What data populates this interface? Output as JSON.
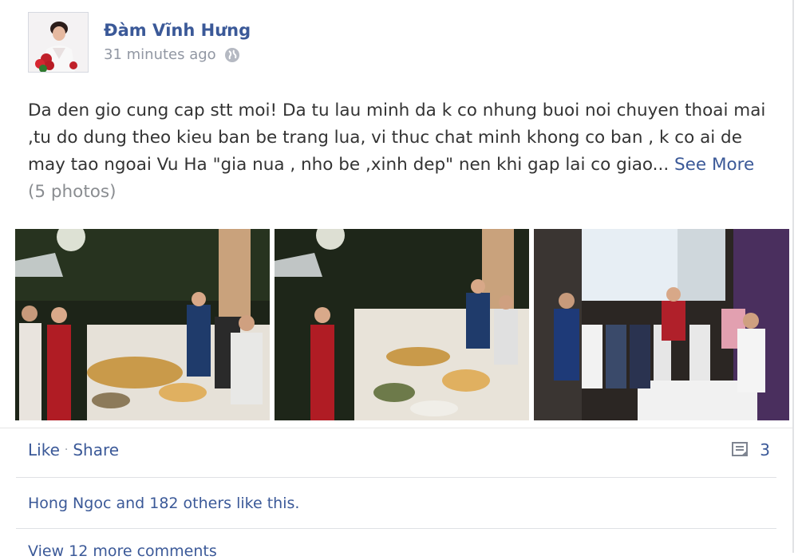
{
  "post": {
    "author": "Đàm Vĩnh Hưng",
    "time": "31 minutes ago",
    "privacy_icon": "globe-icon",
    "text": "Da den gio cung cap stt moi! Da tu lau minh da k co nhung buoi noi chuyen thoai mai ,tu do dung theo kieu ban be trang lua, vi thuc chat minh khong co ban , k co ai de may tao ngoai Vu Ha \"gia nua , nho be ,xinh dep\" nen khi gap lai co giao...",
    "see_more": "See More",
    "photo_count": "(5 photos)"
  },
  "actions": {
    "like": "Like",
    "separator": "·",
    "share": "Share",
    "comment_icon": "comment-icon",
    "comment_count": "3"
  },
  "likes": {
    "name": "Hong Ngoc",
    "rest": " and 182 others like this."
  },
  "comments": {
    "view_more": "View 12 more comments"
  },
  "colors": {
    "link": "#3b5998",
    "meta": "#9197a3",
    "text": "#333333"
  }
}
